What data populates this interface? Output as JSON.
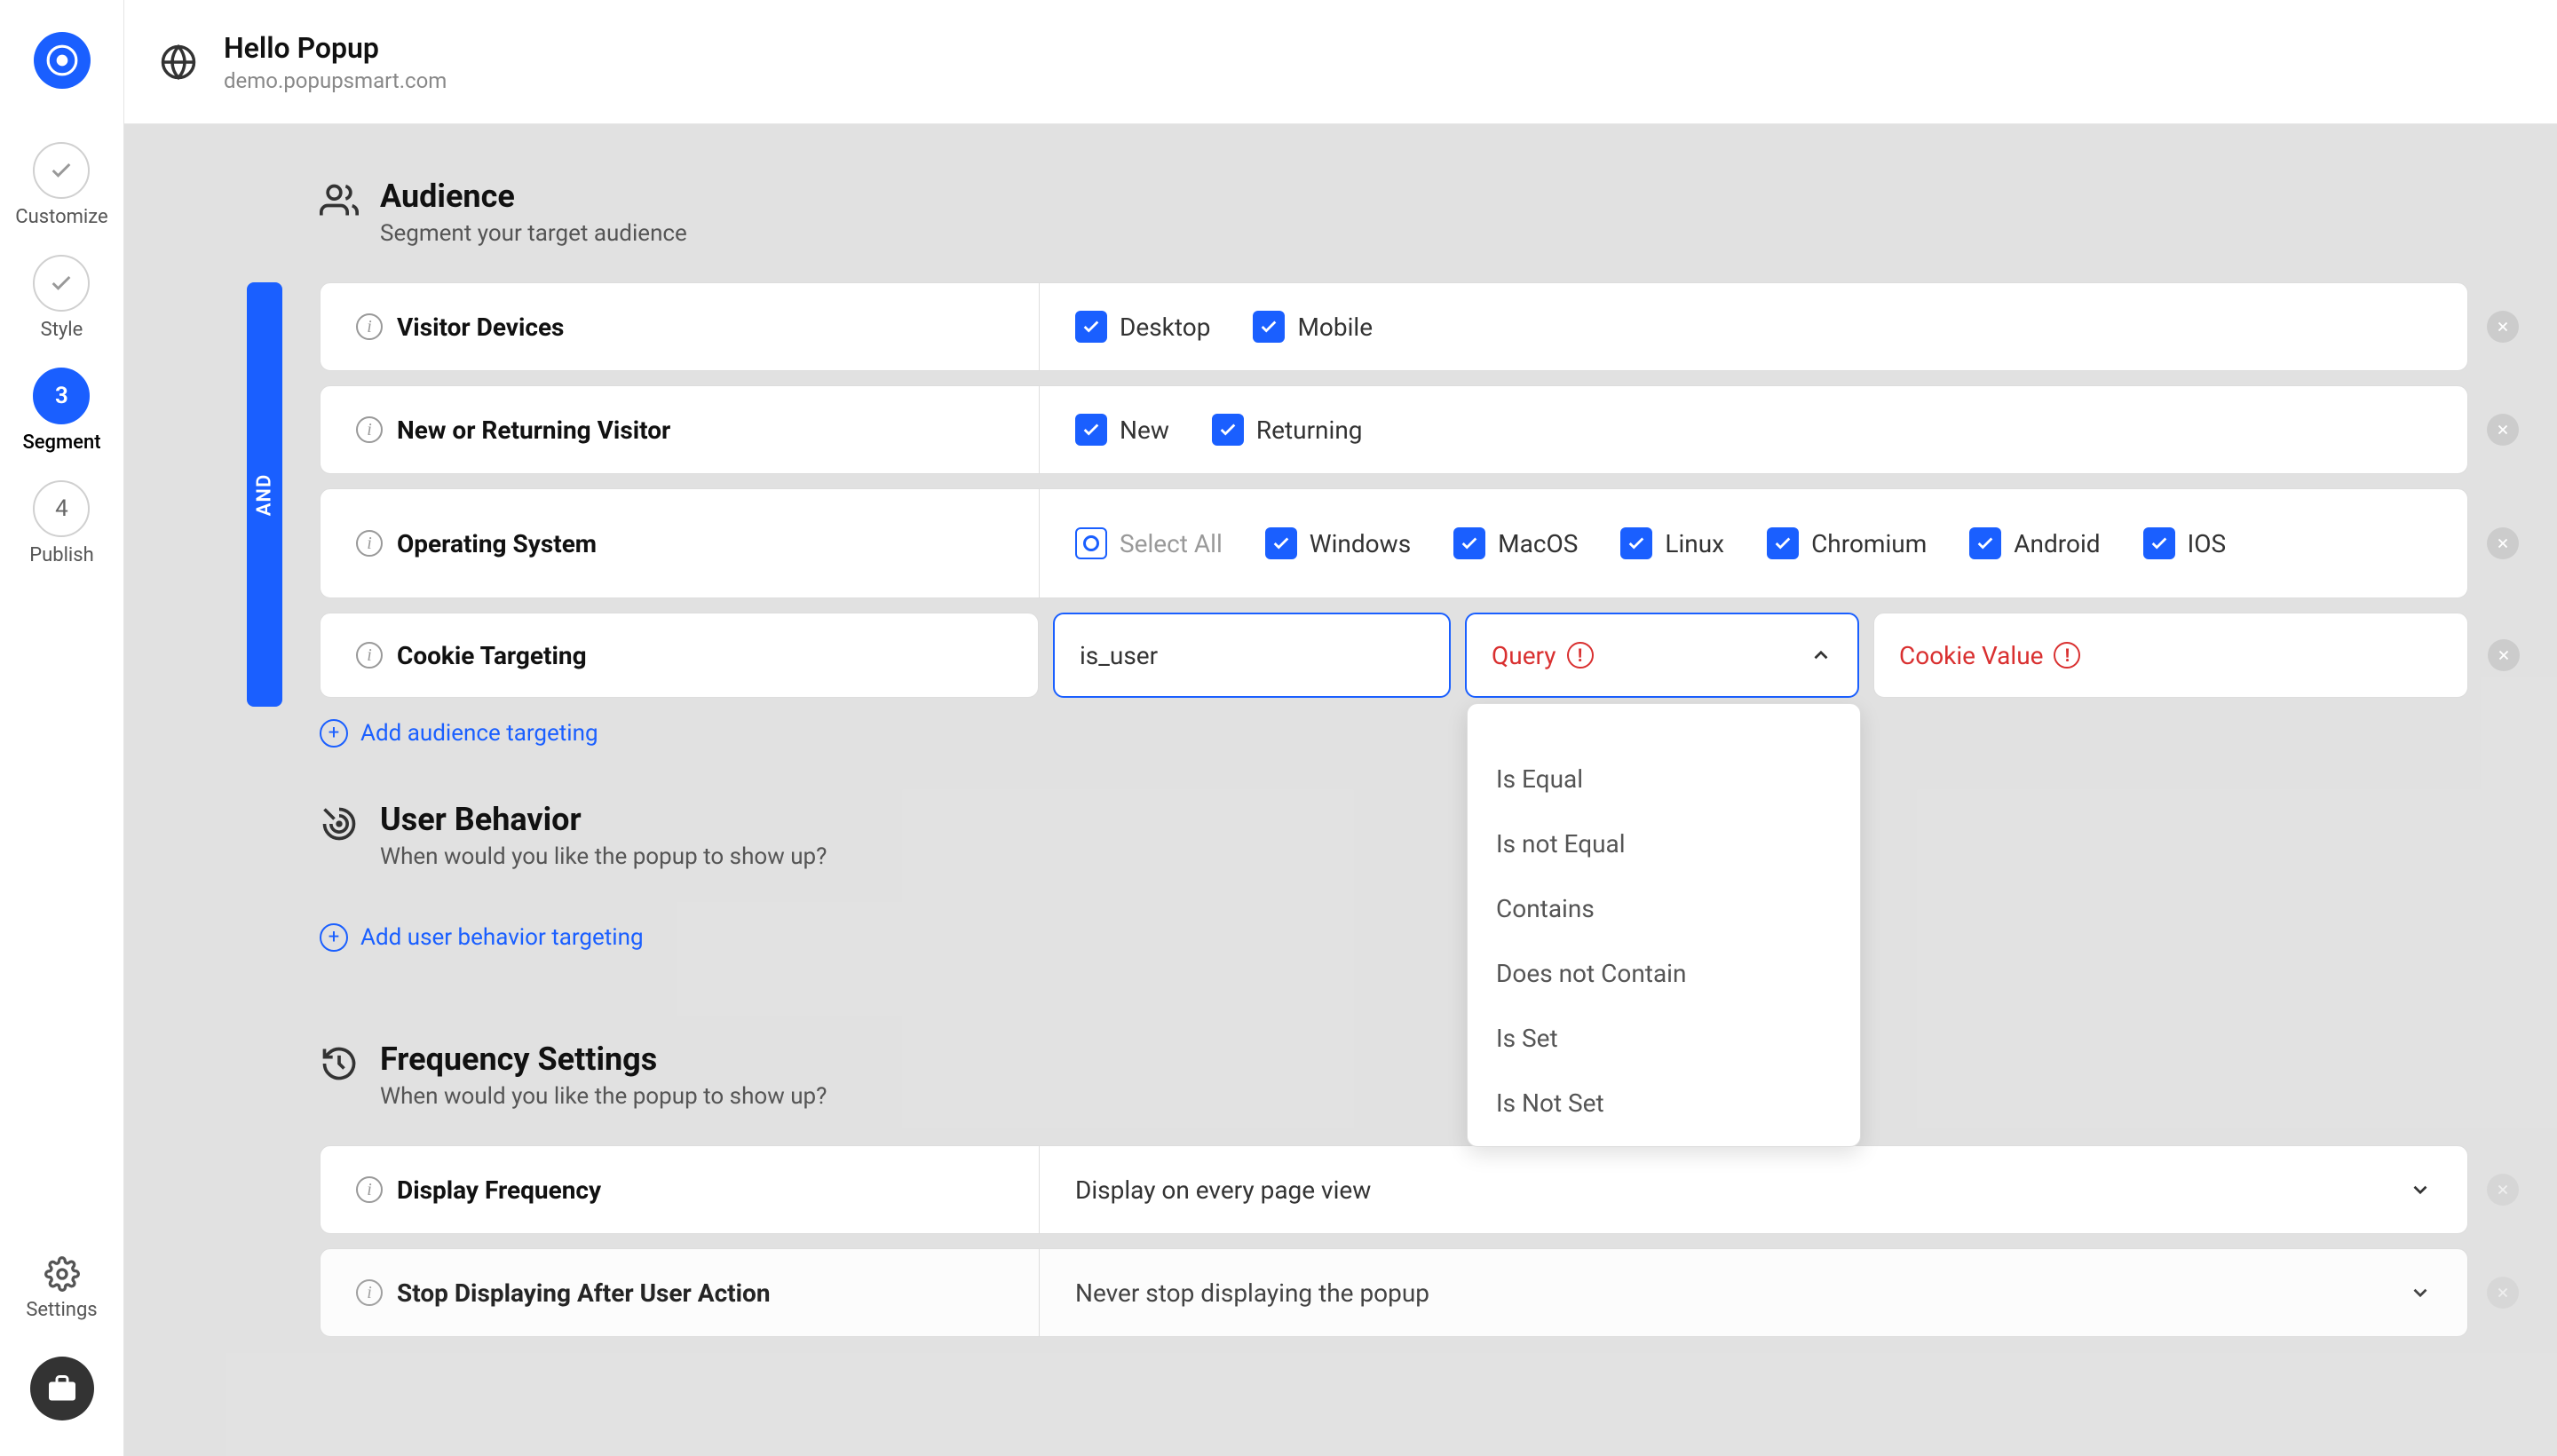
{
  "header": {
    "title": "Hello Popup",
    "subtitle": "demo.popupsmart.com"
  },
  "nav": {
    "customize": "Customize",
    "style": "Style",
    "segment_num": "3",
    "segment": "Segment",
    "publish_num": "4",
    "publish": "Publish",
    "settings": "Settings"
  },
  "audience": {
    "title": "Audience",
    "desc": "Segment your target audience",
    "and": "AND",
    "rows": {
      "devices": {
        "label": "Visitor Devices",
        "desktop": "Desktop",
        "mobile": "Mobile"
      },
      "visitor": {
        "label": "New or Returning Visitor",
        "new": "New",
        "returning": "Returning"
      },
      "os": {
        "label": "Operating System",
        "select_all": "Select All",
        "windows": "Windows",
        "macos": "MacOS",
        "linux": "Linux",
        "chromium": "Chromium",
        "android": "Android",
        "ios": "IOS"
      },
      "cookie": {
        "label": "Cookie Targeting",
        "input_value": "is_user",
        "query": "Query",
        "value_ph": "Cookie Value"
      }
    },
    "dropdown": {
      "is_equal": "Is Equal",
      "is_not_equal": "Is not Equal",
      "contains": "Contains",
      "does_not_contain": "Does not Contain",
      "is_set": "Is Set",
      "is_not_set": "Is Not Set"
    },
    "add": "Add audience targeting"
  },
  "behavior": {
    "title": "User Behavior",
    "desc": "When would you like the popup to show up?",
    "add": "Add user behavior targeting"
  },
  "frequency": {
    "title": "Frequency Settings",
    "desc": "When would you like the popup to show up?",
    "display": {
      "label": "Display Frequency",
      "value": "Display on every page view"
    },
    "stop": {
      "label": "Stop Displaying After User Action",
      "value": "Never stop displaying the popup"
    }
  }
}
